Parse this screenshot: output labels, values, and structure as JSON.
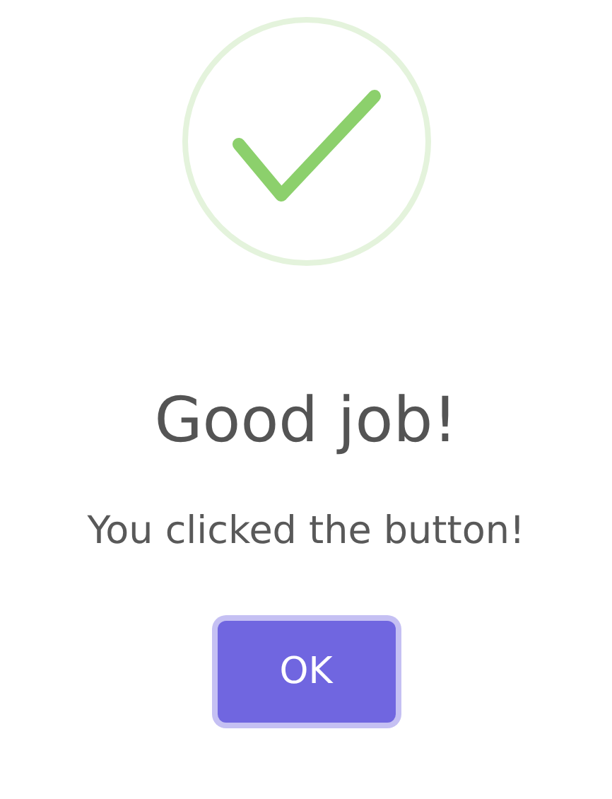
{
  "dialog": {
    "icon": {
      "kind": "success"
    },
    "title": "Good job!",
    "message": "You clicked the button!",
    "buttons": [
      {
        "label": "OK"
      }
    ]
  }
}
